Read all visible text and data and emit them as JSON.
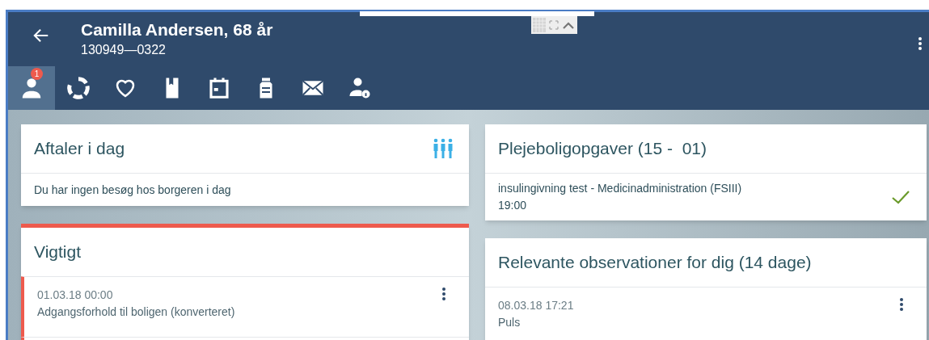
{
  "header": {
    "title": "Camilla Andersen, 68 år",
    "subtitle": "130949—0322"
  },
  "toolbar": [
    {
      "kind": "person",
      "selected": true,
      "badge": "1"
    },
    {
      "kind": "ring",
      "selected": false
    },
    {
      "kind": "heart",
      "selected": false
    },
    {
      "kind": "book",
      "selected": false
    },
    {
      "kind": "calendar",
      "selected": false
    },
    {
      "kind": "bottle",
      "selected": false
    },
    {
      "kind": "mail",
      "selected": false
    },
    {
      "kind": "person-info",
      "selected": false
    }
  ],
  "left": [
    {
      "title": "Aftaler i dag",
      "kind": "appointments",
      "important": false,
      "items": [
        {
          "kind": "note",
          "text": "Du har ingen besøg hos borgeren i dag"
        }
      ]
    },
    {
      "title": "Vigtigt",
      "important": true,
      "items": [
        {
          "kind": "entry",
          "date": "01.03.18 00:00",
          "text": "Adgangsforhold til boligen (konverteret)"
        },
        {
          "kind": "blank"
        }
      ]
    }
  ],
  "right": [
    {
      "title": "Plejeboligopgaver (15 -  01)",
      "important": false,
      "items": [
        {
          "kind": "task",
          "text": "insulingivning test - Medicinadministration (FSIII)",
          "time": "19:00",
          "done": true
        }
      ]
    },
    {
      "title": "Relevante observationer for dig (14 dage)",
      "important": false,
      "items": [
        {
          "kind": "entry",
          "date": "08.03.18 17:21",
          "text": "Puls"
        }
      ]
    }
  ]
}
